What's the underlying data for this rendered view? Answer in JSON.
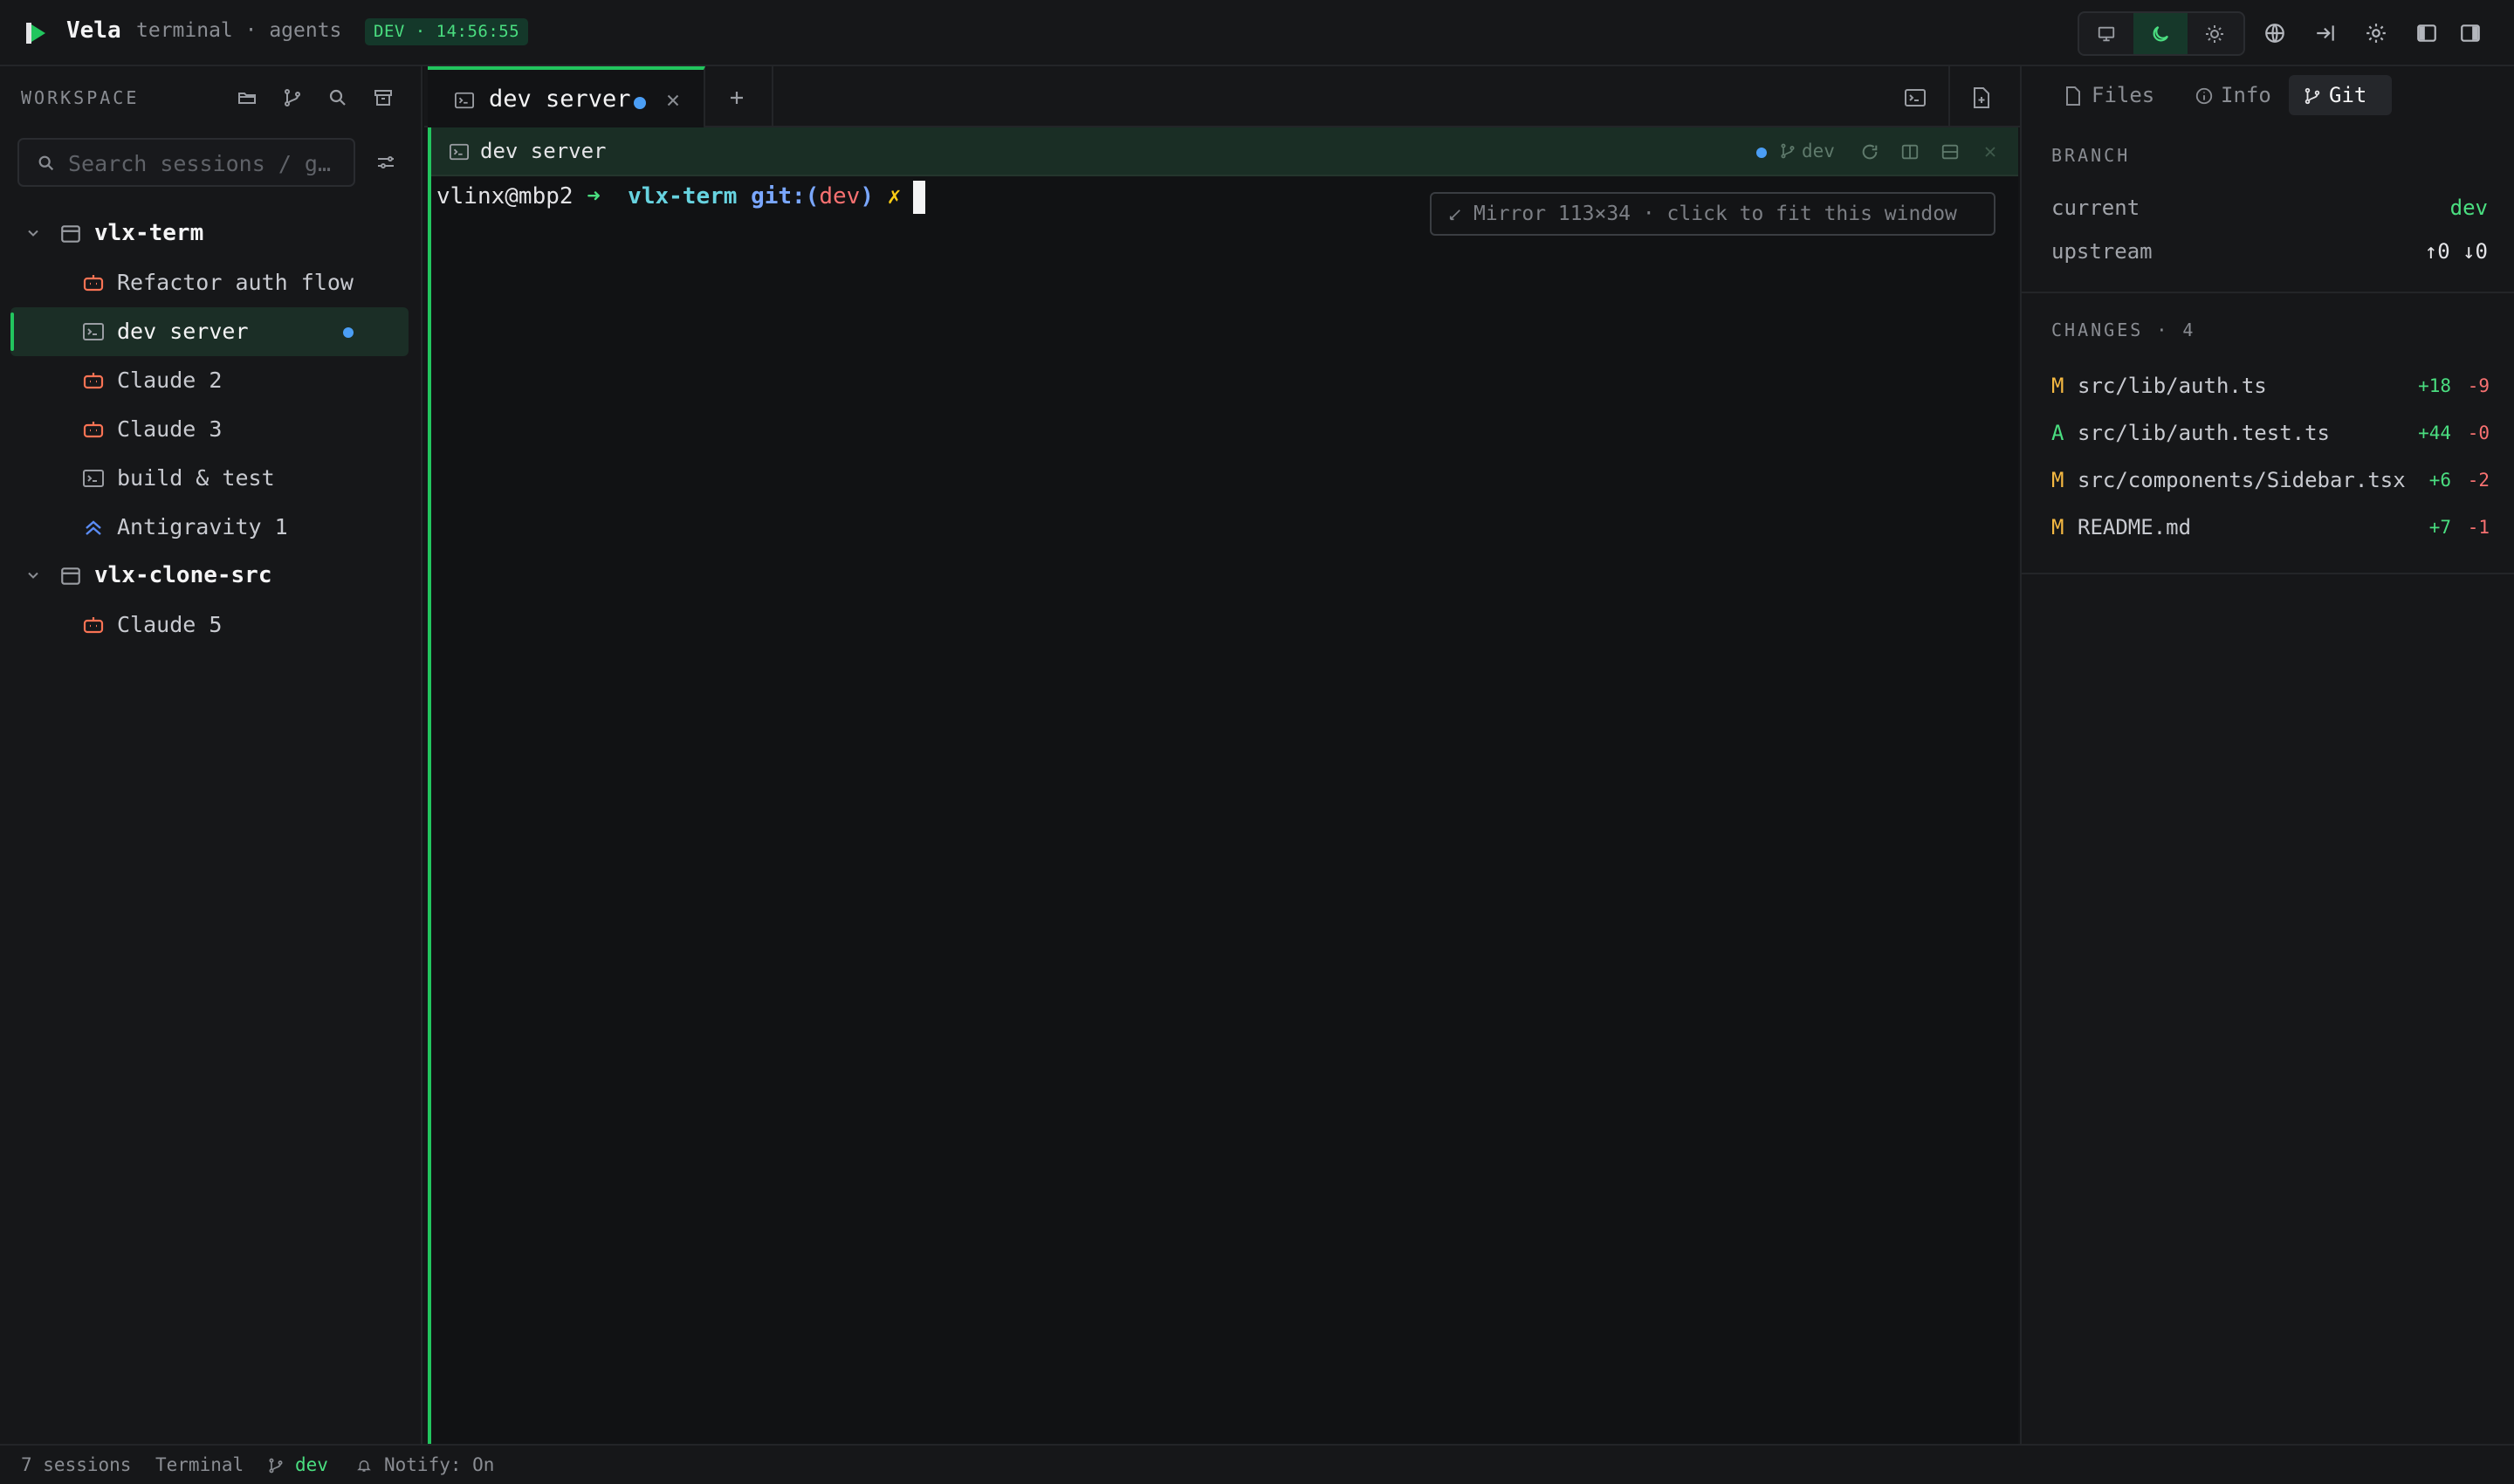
{
  "app": {
    "name": "Vela",
    "subtitle": "terminal · agents",
    "env_badge": "DEV · 14:56:55"
  },
  "topbar_icons": [
    "monitor-icon",
    "moon-icon",
    "sun-icon",
    "globe-icon",
    "sign-in-icon",
    "settings-gear-icon",
    "left-panel-icon",
    "right-panel-icon"
  ],
  "sidebar": {
    "title": "WORKSPACE",
    "search_placeholder": "Search sessions / g…",
    "groups": [
      {
        "name": "vlx-term",
        "items": [
          {
            "label": "Refactor auth flow",
            "icon": "robot-icon",
            "color": "#f97354"
          },
          {
            "label": "dev server",
            "icon": "terminal-icon",
            "active": true,
            "unread": true
          },
          {
            "label": "Claude 2",
            "icon": "robot-icon",
            "color": "#f97354"
          },
          {
            "label": "Claude 3",
            "icon": "robot-icon",
            "color": "#f97354"
          },
          {
            "label": "build & test",
            "icon": "terminal-icon"
          },
          {
            "label": "Antigravity 1",
            "icon": "double-chevron-up-icon",
            "color": "#5b8cf5"
          }
        ]
      },
      {
        "name": "vlx-clone-src",
        "items": [
          {
            "label": "Claude 5",
            "icon": "robot-icon",
            "color": "#f97354"
          }
        ]
      }
    ]
  },
  "tabs": [
    {
      "label": "dev server",
      "active": true,
      "unread": true
    }
  ],
  "pane": {
    "title": "dev server",
    "branch": "dev"
  },
  "terminal": {
    "user": "vlinx@mbp2",
    "arrow": "➜",
    "dir": "vlx-term",
    "git_prefix": "git:(",
    "branch": "dev",
    "git_suffix": ")",
    "dirty": "✗",
    "mirror_notice": "Mirror 113×34 · click to fit this window"
  },
  "right_panel": {
    "tabs": [
      {
        "label": "Files",
        "icon": "file-icon"
      },
      {
        "label": "Info",
        "icon": "info-icon"
      },
      {
        "label": "Git",
        "icon": "git-branch-icon",
        "active": true
      }
    ],
    "branch": {
      "title": "BRANCH",
      "current_label": "current",
      "current_value": "dev",
      "upstream_label": "upstream",
      "upstream_value": "↑0 ↓0"
    },
    "changes": {
      "title": "CHANGES · 4",
      "files": [
        {
          "status": "M",
          "path": "src/lib/auth.ts",
          "added": "+18",
          "removed": "-9"
        },
        {
          "status": "A",
          "path": "src/lib/auth.test.ts",
          "added": "+44",
          "removed": "-0"
        },
        {
          "status": "M",
          "path": "src/components/Sidebar.tsx",
          "added": "+6",
          "removed": "-2"
        },
        {
          "status": "M",
          "path": "README.md",
          "added": "+7",
          "removed": "-1"
        }
      ]
    }
  },
  "status_bar": {
    "sessions": "7 sessions",
    "mode": "Terminal",
    "branch": "dev",
    "notify": "Notify: On"
  },
  "colors": {
    "accent": "#22c55e",
    "unread_dot": "#4b9ef5",
    "modified": "#f5b942",
    "added": "#4ade80",
    "removed": "#f87171"
  }
}
